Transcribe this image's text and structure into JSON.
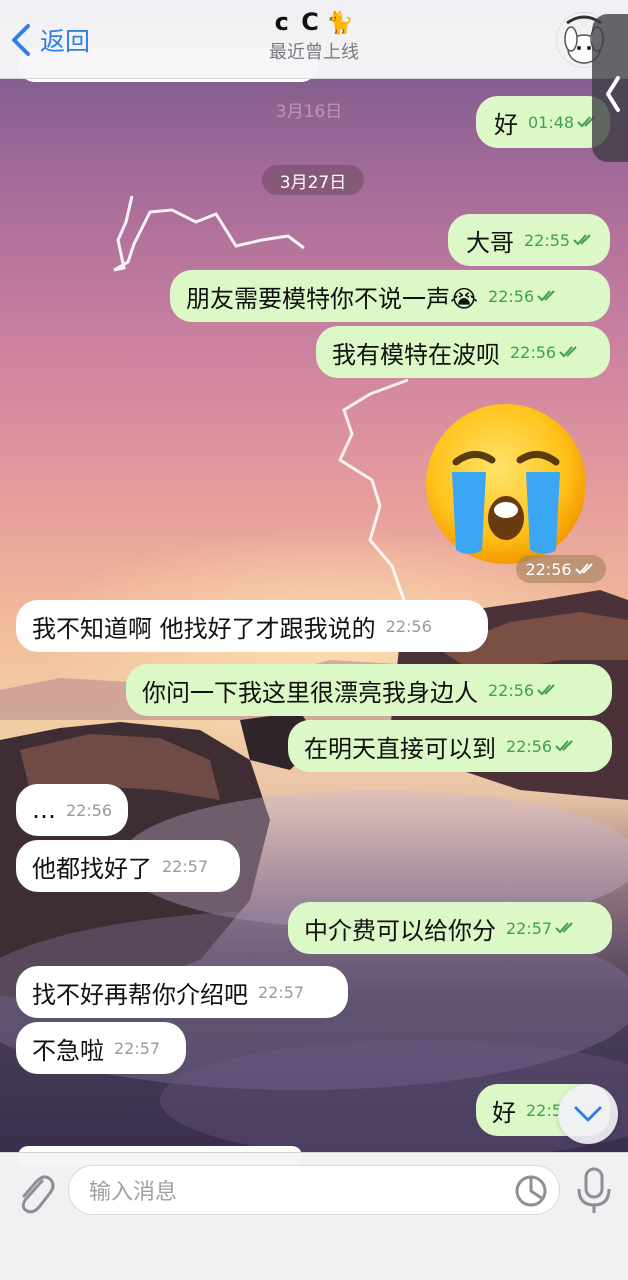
{
  "header": {
    "back_label": "返回",
    "title": "c C",
    "title_emoji": "🐈",
    "status": "最近曾上线"
  },
  "dates": {
    "faded": "3月16日",
    "current": "3月27日"
  },
  "messages": [
    {
      "dir": "out",
      "text": "好",
      "time": "01:48"
    },
    {
      "dir": "out",
      "text": "大哥",
      "time": "22:55"
    },
    {
      "dir": "out",
      "text": "朋友需要模特你不说一声😭",
      "time": "22:56"
    },
    {
      "dir": "out",
      "text": "我有模特在波呗",
      "time": "22:56"
    },
    {
      "dir": "out",
      "sticker": "loudly-crying-face",
      "time": "22:56"
    },
    {
      "dir": "in",
      "text": "我不知道啊 他找好了才跟我说的",
      "time": "22:56"
    },
    {
      "dir": "out",
      "text": "你问一下我这里很漂亮我身边人",
      "time": "22:56"
    },
    {
      "dir": "out",
      "text": "在明天直接可以到",
      "time": "22:56"
    },
    {
      "dir": "in",
      "text": "…",
      "time": "22:56"
    },
    {
      "dir": "in",
      "text": "他都找好了",
      "time": "22:57"
    },
    {
      "dir": "out",
      "text": "中介费可以给你分",
      "time": "22:57"
    },
    {
      "dir": "in",
      "text": "找不好再帮你介绍吧",
      "time": "22:57"
    },
    {
      "dir": "in",
      "text": "不急啦",
      "time": "22:57"
    },
    {
      "dir": "out",
      "text": "好",
      "time": "22:5"
    }
  ],
  "composer": {
    "placeholder": "输入消息"
  },
  "icons": {
    "back": "chevron-left-icon",
    "attach": "paperclip-icon",
    "sticker": "sticker-icon",
    "mic": "microphone-icon",
    "scroll": "chevron-down-icon",
    "side": "chevron-left-icon"
  },
  "colors": {
    "accent": "#2f7fe6",
    "outgoing_bubble": "#dcf8c6",
    "incoming_bubble": "#ffffff",
    "check": "#3fa24a"
  }
}
